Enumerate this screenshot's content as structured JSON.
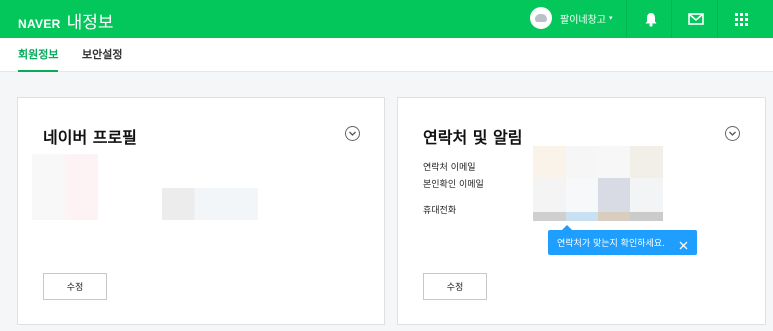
{
  "header": {
    "logo": "NAVER",
    "service": "내정보",
    "account_name": "팔이네창고",
    "caret": "▾",
    "icons": [
      "notification-bell-icon",
      "mail-icon",
      "app-grid-icon"
    ],
    "brand_color": "#03c75a"
  },
  "tabs": [
    {
      "label": "회원정보",
      "active": true
    },
    {
      "label": "보안설정",
      "active": false
    }
  ],
  "profile_card": {
    "title": "네이버 프로필",
    "expand_icon": "chevron-down-circle-icon",
    "edit_label": "수정"
  },
  "contact_card": {
    "title": "연락처 및 알림",
    "expand_icon": "chevron-down-circle-icon",
    "labels": [
      "연락처 이메일",
      "본인확인 이메일",
      "휴대전화"
    ],
    "edit_label": "수정"
  },
  "tooltip": {
    "text": "연락처가 맞는지 확인하세요.",
    "close_icon": "close-icon",
    "color": "#1e9eff"
  }
}
